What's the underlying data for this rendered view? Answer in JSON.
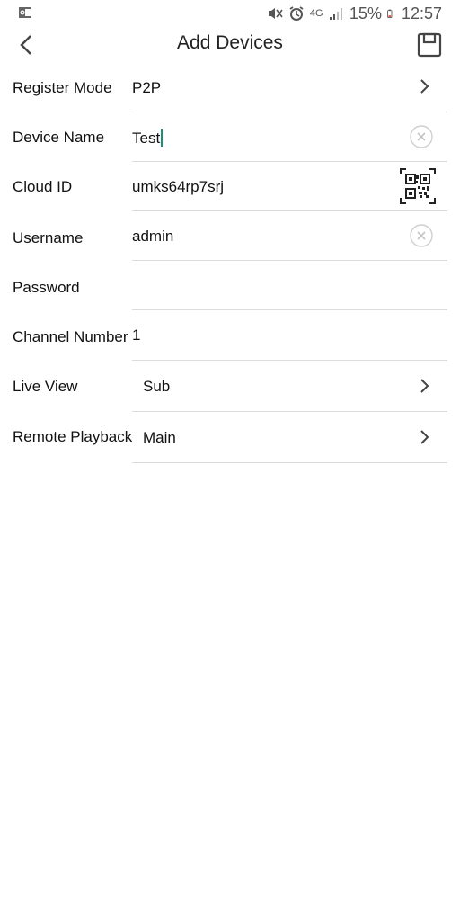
{
  "status_bar": {
    "battery": "15%",
    "time": "12:57",
    "network": "4G",
    "icons": [
      "outlook-icon",
      "mute-icon",
      "alarm-icon",
      "network-4g-icon",
      "signal-icon",
      "battery-icon"
    ]
  },
  "header": {
    "title": "Add Devices",
    "back_icon": "chevron-left-icon",
    "save_icon": "save-icon"
  },
  "form": {
    "register_mode": {
      "label": "Register Mode",
      "value": "P2P"
    },
    "device_name": {
      "label": "Device Name",
      "value": "Test"
    },
    "cloud_id": {
      "label": "Cloud ID",
      "value": "umks64rp7srj"
    },
    "username": {
      "label": "Username",
      "value": "admin"
    },
    "password": {
      "label": "Password",
      "value": ""
    },
    "channel_number": {
      "label": "Channel Number",
      "value": "1"
    },
    "live_view": {
      "label": "Live View",
      "value": "Sub"
    },
    "remote_playback": {
      "label": "Remote Playback",
      "value": "Main"
    }
  },
  "colors": {
    "accent_cursor": "#1a8f7a",
    "divider": "#dcdcdc",
    "icon_gray": "#555555"
  }
}
